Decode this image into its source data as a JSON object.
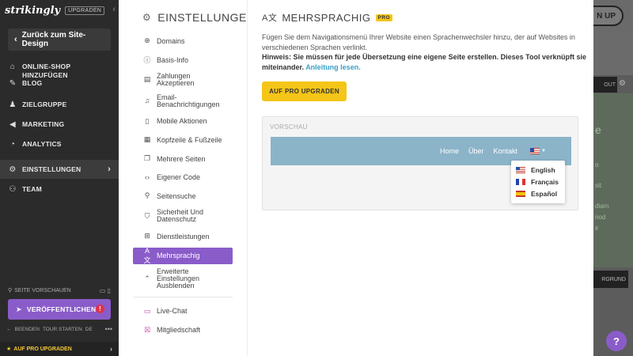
{
  "sidebar": {
    "logo": "strikingly",
    "upgrade_tag": "UPGRADEN",
    "back_label": "Zurück zum Site-Design",
    "items": [
      {
        "label": "ONLINE-SHOP HINZUFÜGEN",
        "icon": "shop-icon"
      },
      {
        "label": "BLOG",
        "icon": "blog-icon"
      },
      {
        "label": "ZIELGRUPPE",
        "icon": "audience-icon"
      },
      {
        "label": "MARKETING",
        "icon": "megaphone-icon"
      },
      {
        "label": "ANALYTICS",
        "icon": "chart-icon"
      },
      {
        "label": "EINSTELLUNGEN",
        "icon": "gear-icon"
      },
      {
        "label": "TEAM",
        "icon": "team-icon"
      }
    ],
    "preview_label": "SEITE VORSCHAUEN",
    "publish_label": "VERÖFFENTLICHEN",
    "publish_alert": "!",
    "footer": {
      "quit": "BEENDEN",
      "tour": "TOUR STARTEN",
      "lang": "DE",
      "more": "•••"
    },
    "pro_upgrade": "AUF PRO UPGRADEN"
  },
  "settings": {
    "title": "EINSTELLUNGEN",
    "menu": [
      {
        "label": "Domains",
        "icon": "globe-icon"
      },
      {
        "label": "Basis-Info",
        "icon": "info-icon"
      },
      {
        "label": "Zahlungen Akzeptieren",
        "icon": "payment-icon"
      },
      {
        "label": "Email-Benachrichtigungen",
        "icon": "bell-icon"
      },
      {
        "label": "Mobile Aktionen",
        "icon": "mobile-icon"
      },
      {
        "label": "Kopfzeile & Fußzeile",
        "icon": "header-footer-icon"
      },
      {
        "label": "Mehrere Seiten",
        "icon": "pages-icon"
      },
      {
        "label": "Eigener Code",
        "icon": "code-icon"
      },
      {
        "label": "Seitensuche",
        "icon": "search-icon"
      },
      {
        "label": "Sicherheit Und Datenschutz",
        "icon": "shield-icon"
      },
      {
        "label": "Dienstleistungen",
        "icon": "grid-icon"
      },
      {
        "label": "Mehrsprachig",
        "icon": "translate-icon"
      },
      {
        "label": "Erweiterte Einstellungen Ausblenden",
        "icon": "chevron-up-icon"
      },
      {
        "label": "Live-Chat",
        "icon": "chat-icon"
      },
      {
        "label": "Mitgliedschaft",
        "icon": "member-icon"
      }
    ]
  },
  "content": {
    "title": "MEHRSPRACHIG",
    "pro_badge": "PRO",
    "description": "Fügen Sie dem Navigationsmenü Ihrer Website einen Sprachenwechsler hinzu, der auf Websites in verschiedenen Sprachen verlinkt.",
    "hint": "Hinweis: Sie müssen für jede Übersetzung eine eigene Seite erstellen. Dieses Tool verknüpft sie miteinander.",
    "hint_link": "Anleitung lesen.",
    "upgrade_button": "AUF PRO UPGRADEN",
    "preview_label": "VORSCHAU",
    "preview_nav": [
      "Home",
      "Über",
      "Kontakt"
    ],
    "languages": [
      "English",
      "Français",
      "Español"
    ]
  },
  "site_preview": {
    "signup": "N UP",
    "checkout": "OUT",
    "button": "RGRUND",
    "text_lines": [
      "e",
      "o",
      "sit",
      "diam",
      "nod",
      "ir"
    ]
  },
  "help": "?"
}
